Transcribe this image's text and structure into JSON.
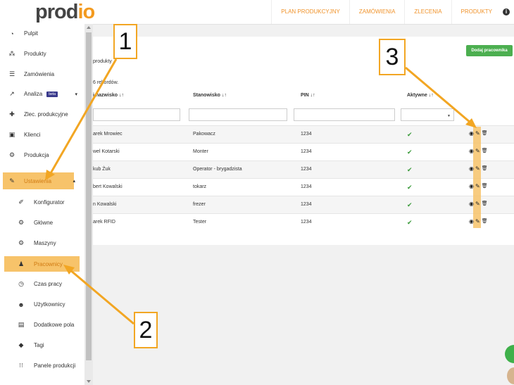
{
  "header": {
    "logo_main": "prod",
    "logo_accent": "io",
    "nav": [
      "PLAN PRODUKCYJNY",
      "ZAMÓWIENIA",
      "ZLECENIA",
      "PRODUKTY"
    ],
    "info_icon": "i"
  },
  "sidebar": {
    "items": [
      {
        "label": "Pulpit",
        "icon": "dashboard-icon",
        "glyph": "◔"
      },
      {
        "label": "Produkty",
        "icon": "cubes-icon",
        "glyph": "⁂"
      },
      {
        "label": "Zamówienia",
        "icon": "list-icon",
        "glyph": "☰"
      },
      {
        "label": "Analiza",
        "icon": "chart-icon",
        "glyph": "↗",
        "badge": "beta"
      },
      {
        "label": "Zlec. produkcyjne",
        "icon": "puzzle-icon",
        "glyph": "✚"
      },
      {
        "label": "Klienci",
        "icon": "briefcase-icon",
        "glyph": "▣"
      },
      {
        "label": "Produkcja",
        "icon": "gears-icon",
        "glyph": "⚙"
      },
      {
        "label": "Ustawienia",
        "icon": "wrench-icon",
        "glyph": "✎"
      }
    ],
    "sub_items": [
      {
        "label": "Konfigurator",
        "icon": "magic-icon",
        "glyph": "✐"
      },
      {
        "label": "Główne",
        "icon": "gear-icon",
        "glyph": "⚙"
      },
      {
        "label": "Maszyny",
        "icon": "cogs-icon",
        "glyph": "⚙"
      },
      {
        "label": "Pracownicy",
        "icon": "person-icon",
        "glyph": "♟"
      },
      {
        "label": "Czas pracy",
        "icon": "clock-icon",
        "glyph": "◷"
      },
      {
        "label": "Użytkownicy",
        "icon": "users-icon",
        "glyph": "☻"
      },
      {
        "label": "Dodatkowe pola",
        "icon": "contact-card-icon",
        "glyph": "▤"
      },
      {
        "label": "Tagi",
        "icon": "tags-icon",
        "glyph": "◆"
      },
      {
        "label": "Panele produkcji",
        "icon": "grid-icon",
        "glyph": "⁝⁝"
      }
    ]
  },
  "main": {
    "add_button": "Dodaj pracownika",
    "breadcrumb": "produkty",
    "records_text": "6 rekordów.",
    "columns": [
      "i nazwisko ↓↑",
      "Stanowisko ↓↑",
      "PIN ↓↑",
      "Aktywne ↓↑"
    ],
    "rows": [
      {
        "name": "arek Mrowiec",
        "position": "Pakowacz",
        "pin": "1234",
        "active": "✔"
      },
      {
        "name": "wel Kotarski",
        "position": "Monter",
        "pin": "1234",
        "active": "✔"
      },
      {
        "name": "kub Żuk",
        "position": "Operator - brygadzista",
        "pin": "1234",
        "active": "✔"
      },
      {
        "name": "bert Kowalski",
        "position": "tokarz",
        "pin": "1234",
        "active": "✔"
      },
      {
        "name": "n Kowalski",
        "position": "frezer",
        "pin": "1234",
        "active": "✔"
      },
      {
        "name": "arek RFID",
        "position": "Tester",
        "pin": "1234",
        "active": "✔"
      }
    ],
    "action_icons": {
      "view": "◉",
      "edit": "✎",
      "delete": "🗑"
    }
  },
  "callouts": [
    "1",
    "2",
    "3"
  ],
  "colors": {
    "accent": "#f39a1f",
    "highlight": "#f7c36a",
    "success": "#4caf50"
  }
}
